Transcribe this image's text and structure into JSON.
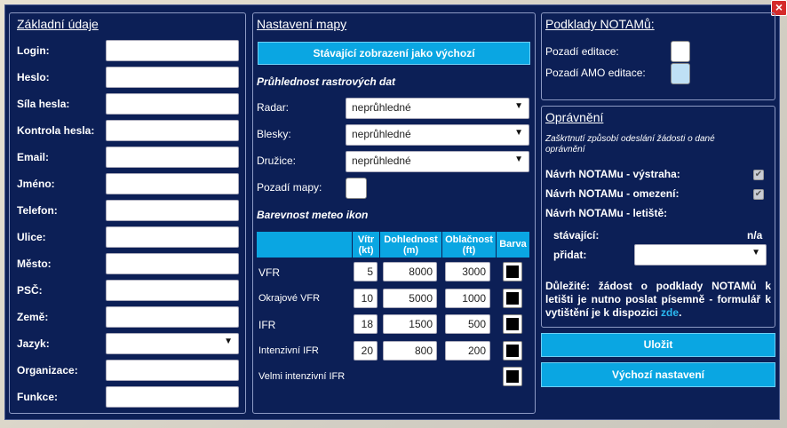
{
  "close_icon": "×",
  "basic": {
    "title": "Základní údaje",
    "fields": [
      {
        "label": "Login:"
      },
      {
        "label": "Heslo:"
      },
      {
        "label": "Síla hesla:"
      },
      {
        "label": "Kontrola hesla:"
      },
      {
        "label": "Email:"
      },
      {
        "label": "Jméno:"
      },
      {
        "label": "Telefon:"
      },
      {
        "label": "Ulice:"
      },
      {
        "label": "Město:"
      },
      {
        "label": "PSČ:"
      },
      {
        "label": "Země:"
      },
      {
        "label": "Jazyk:"
      },
      {
        "label": "Organizace:"
      },
      {
        "label": "Funkce:"
      }
    ],
    "language_value": ""
  },
  "map": {
    "title": "Nastavení mapy",
    "default_view_button": "Stávající zobrazení jako výchozí",
    "raster_heading": "Průhlednost rastrových dat",
    "radar_label": "Radar:",
    "radar_value": "neprůhledné",
    "lightning_label": "Blesky:",
    "lightning_value": "neprůhledné",
    "satellite_label": "Družice:",
    "satellite_value": "neprůhledné",
    "background_label": "Pozadí mapy:",
    "meteo_heading": "Barevnost meteo ikon",
    "table": {
      "headers": [
        "Vítr (kt)",
        "Dohlednost (m)",
        "Oblačnost (ft)",
        "Barva"
      ],
      "rows": [
        {
          "label": "VFR",
          "wind": "5",
          "visibility": "8000",
          "cloud": "3000"
        },
        {
          "label": "Okrajové VFR",
          "wind": "10",
          "visibility": "5000",
          "cloud": "1000"
        },
        {
          "label": "IFR",
          "wind": "18",
          "visibility": "1500",
          "cloud": "500"
        },
        {
          "label": "Intenzivní IFR",
          "wind": "20",
          "visibility": "800",
          "cloud": "200"
        },
        {
          "label": "Velmi intenzivní IFR"
        }
      ]
    }
  },
  "notam": {
    "title": "Podklady NOTAMů:",
    "edit_bg_label": "Pozadí editace:",
    "amo_bg_label": "Pozadí AMO editace:",
    "edit_bg_color": "#ffffff",
    "amo_bg_color": "#bfe0f5"
  },
  "perm": {
    "title": "Oprávnění",
    "note": "Zaškrtnutí způsobí odeslání žádosti o dané oprávnění",
    "warning_label": "Návrh NOTAMu - výstraha:",
    "restriction_label": "Návrh NOTAMu - omezení:",
    "airport_label": "Návrh NOTAMu - letiště:",
    "current_label": "stávající:",
    "current_value": "n/a",
    "add_label": "přidat:",
    "important_bold": "Důležité:",
    "important_text": " žádost o podklady NOTAMů k letišti je nutno poslat písemně - formulář k vytištění je k dispozici ",
    "important_link": "zde",
    "important_end": "."
  },
  "actions": {
    "save": "Uložit",
    "defaults": "Výchozí nastavení"
  }
}
